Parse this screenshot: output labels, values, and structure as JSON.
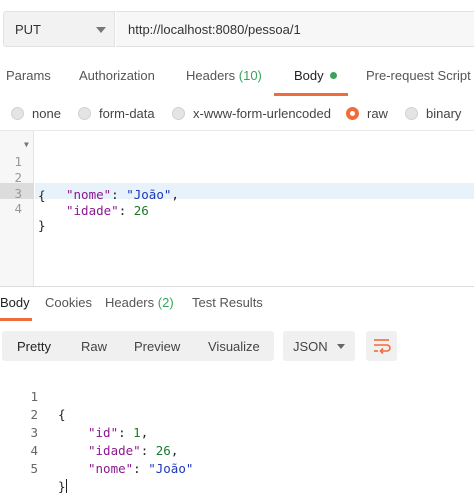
{
  "request": {
    "method": "PUT",
    "url": "http://localhost:8080/pessoa/1"
  },
  "request_tabs": [
    {
      "label": "Params"
    },
    {
      "label": "Authorization"
    },
    {
      "label": "Headers",
      "count": "(10)"
    },
    {
      "label": "Body",
      "active": true
    },
    {
      "label": "Pre-request Script"
    }
  ],
  "body_types": [
    {
      "label": "none"
    },
    {
      "label": "form-data"
    },
    {
      "label": "x-www-form-urlencoded"
    },
    {
      "label": "raw",
      "selected": true
    },
    {
      "label": "binary"
    }
  ],
  "request_editor": {
    "lines": [
      {
        "no": "1",
        "text": "{"
      },
      {
        "no": "2",
        "key": "\"nome\"",
        "value": "\"João\"",
        "trail": ","
      },
      {
        "no": "3",
        "key": "\"idade\"",
        "value": "26",
        "trail": ""
      },
      {
        "no": "4",
        "text": "}"
      }
    ]
  },
  "response_tabs": [
    {
      "label": "Body",
      "active": true
    },
    {
      "label": "Cookies"
    },
    {
      "label": "Headers",
      "count": "(2)"
    },
    {
      "label": "Test Results"
    }
  ],
  "response_views": [
    "Pretty",
    "Raw",
    "Preview",
    "Visualize"
  ],
  "response_format": "JSON",
  "response_editor": {
    "lines": [
      {
        "no": "1",
        "text": "{"
      },
      {
        "no": "2",
        "key": "\"id\"",
        "value": "1",
        "trail": ","
      },
      {
        "no": "3",
        "key": "\"idade\"",
        "value": "26",
        "trail": ","
      },
      {
        "no": "4",
        "key": "\"nome\"",
        "value": "\"João\"",
        "trail": ""
      },
      {
        "no": "5",
        "text": "}"
      }
    ]
  },
  "colors": {
    "accent": "#f26b3a",
    "count_green": "#3aa35a",
    "json_key": "#8a1a8f",
    "json_string": "#1c39b6",
    "json_number": "#1c7a2f"
  }
}
